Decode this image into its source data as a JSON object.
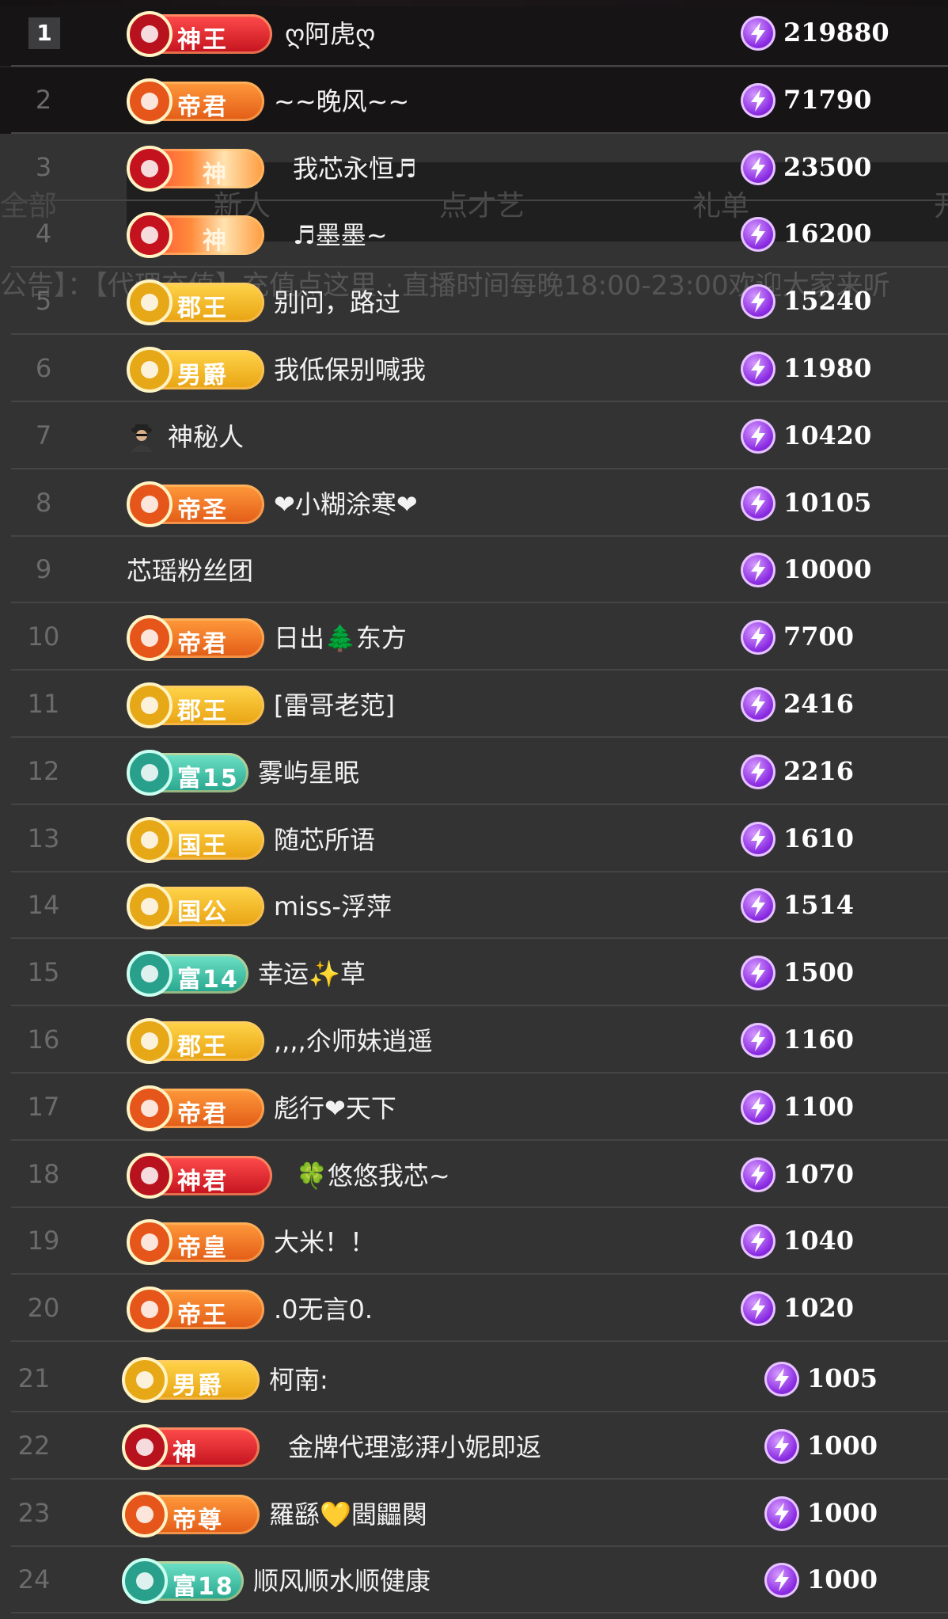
{
  "background": {
    "tabs": [
      "全部",
      "新人",
      "点才艺",
      "礼单",
      "开"
    ],
    "notice": "公告】：【代理充值】充值点这里 · 直播时间每晚18:00-23:00欢迎大家来听"
  },
  "colors": {
    "bg": "#333334",
    "score_gem": "#8a2be2",
    "separator": "#454547"
  },
  "icons": {
    "score": "lightning-gem-icon",
    "anonymous": "mystery-person-icon"
  },
  "rows": [
    {
      "rank": "1",
      "badge": "神王",
      "badge_style": "red",
      "name": "ღ阿虎ღ",
      "score": "219880"
    },
    {
      "rank": "2",
      "badge": "帝君",
      "badge_style": "orange",
      "name": "~~晚风~~",
      "score": "71790"
    },
    {
      "rank": "3",
      "badge": "神",
      "badge_style": "shenwhite",
      "name": "我芯永恒♬",
      "score": "23500"
    },
    {
      "rank": "4",
      "badge": "神",
      "badge_style": "shenwhite",
      "name": "♬墨墨~",
      "score": "16200"
    },
    {
      "rank": "5",
      "badge": "郡王",
      "badge_style": "gold",
      "name": "别问，路过",
      "score": "15240"
    },
    {
      "rank": "6",
      "badge": "男爵",
      "badge_style": "gold",
      "name": "我低保别喊我",
      "score": "11980"
    },
    {
      "rank": "7",
      "badge": "",
      "badge_style": "mystery",
      "name": "神秘人",
      "score": "10420"
    },
    {
      "rank": "8",
      "badge": "帝圣",
      "badge_style": "orange",
      "name": "❤小糊涂寒❤",
      "score": "10105"
    },
    {
      "rank": "9",
      "badge": "",
      "badge_style": "none",
      "name": "芯瑶粉丝团",
      "score": "10000"
    },
    {
      "rank": "10",
      "badge": "帝君",
      "badge_style": "orange",
      "name": "日出🌲东方",
      "score": "7700"
    },
    {
      "rank": "11",
      "badge": "郡王",
      "badge_style": "gold",
      "name": "[雷哥老范]",
      "score": "2416"
    },
    {
      "rank": "12",
      "badge": "富15",
      "badge_style": "teal",
      "name": "雾屿星眠",
      "score": "2216"
    },
    {
      "rank": "13",
      "badge": "国王",
      "badge_style": "gold",
      "name": "随芯所语",
      "score": "1610"
    },
    {
      "rank": "14",
      "badge": "国公",
      "badge_style": "gold",
      "name": "miss-浮萍",
      "score": "1514"
    },
    {
      "rank": "15",
      "badge": "富14",
      "badge_style": "teal",
      "name": "幸运✨草",
      "score": "1500"
    },
    {
      "rank": "16",
      "badge": "郡王",
      "badge_style": "gold",
      "name": ",,,,尒师妹逍遥",
      "score": "1160"
    },
    {
      "rank": "17",
      "badge": "帝君",
      "badge_style": "orange",
      "name": "彪行❤天下",
      "score": "1100"
    },
    {
      "rank": "18",
      "badge": "神君",
      "badge_style": "red",
      "name": "🍀悠悠我芯~",
      "score": "1070"
    },
    {
      "rank": "19",
      "badge": "帝皇",
      "badge_style": "orange",
      "name": "大米！！",
      "score": "1040"
    },
    {
      "rank": "20",
      "badge": "帝王",
      "badge_style": "orange",
      "name": ".0无言0.",
      "score": "1020"
    },
    {
      "rank": "21",
      "badge": "男爵",
      "badge_style": "gold",
      "name": "柯南:",
      "score": "1005"
    },
    {
      "rank": "22",
      "badge": "神",
      "badge_style": "red",
      "name": "金牌代理澎湃小妮即返",
      "score": "1000"
    },
    {
      "rank": "23",
      "badge": "帝尊",
      "badge_style": "orange",
      "name": "羅繇💛閸鼺闋",
      "score": "1000"
    },
    {
      "rank": "24",
      "badge": "富18",
      "badge_style": "teal",
      "name": "顺风顺水顺健康",
      "score": "1000"
    }
  ]
}
